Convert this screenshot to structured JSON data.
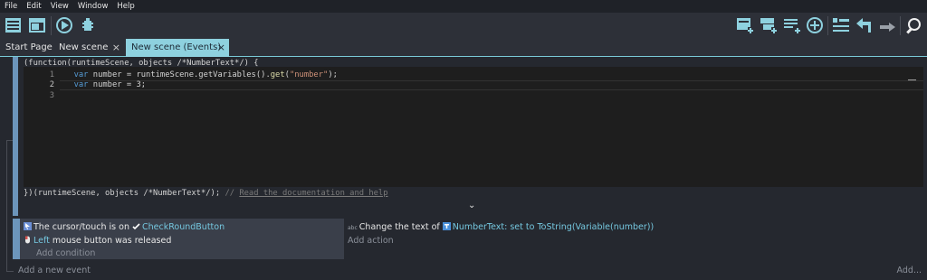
{
  "menubar": {
    "items": [
      "File",
      "Edit",
      "View",
      "Window",
      "Help"
    ]
  },
  "toolbar": {
    "left": [
      "project-manager-icon",
      "scene-editor-icon",
      "preview-play-icon",
      "debugger-icon"
    ],
    "right": [
      "add-event-icon",
      "add-sub-event-icon",
      "add-comment-icon",
      "add-other-icon",
      "select-icon",
      "undo-icon",
      "redo-icon",
      "search-icon"
    ]
  },
  "tabs": [
    {
      "label": "Start Page",
      "closable": false,
      "active": false
    },
    {
      "label": "New scene",
      "closable": true,
      "active": false
    },
    {
      "label": "New scene (Events)",
      "closable": true,
      "active": true
    }
  ],
  "close_glyph": "×",
  "code_block": {
    "header": "(function(runtimeScene, objects /*NumberText*/) {",
    "line_numbers": [
      "1",
      "2",
      "3"
    ],
    "lines": [
      {
        "indent": "  ",
        "kw": "var",
        "rest": " number = runtimeScene.getVariables().",
        "fn": "get",
        "open": "(",
        "str": "\"number\"",
        "close": ");"
      },
      {
        "indent": "  ",
        "kw": "var",
        "rest": " number = 3;",
        "fn": "",
        "open": "",
        "str": "",
        "close": ""
      },
      {
        "indent": "",
        "kw": "",
        "rest": "",
        "fn": "",
        "open": "",
        "str": "",
        "close": ""
      }
    ],
    "footer_code": "})(runtimeScene, objects /*NumberText*/);",
    "footer_comment": " // ",
    "doc_link": "Read the documentation and help",
    "expand_icon": "chevron-down-icon",
    "expand_glyph": "⌄"
  },
  "event": {
    "conditions": [
      {
        "icon": "cursor-icon",
        "text": "The cursor/touch is on ",
        "object_icon": "button-object-icon",
        "object": "CheckRoundButton"
      },
      {
        "icon": "mouse-icon",
        "param": "Left",
        "text": " mouse button was released"
      }
    ],
    "add_condition": "Add condition",
    "actions": [
      {
        "icon": "text-icon",
        "prefix": "abc",
        "text": "Change the text of ",
        "object_icon": "text-object-icon",
        "object": "NumberText",
        "rest": ": set to ",
        "param": "ToString(Variable(number))"
      }
    ],
    "add_action": "Add action"
  },
  "footer": {
    "add_event": "Add a new event",
    "add_more": "Add..."
  },
  "colors": {
    "accent": "#8ed1df",
    "block_border": "#6c95bb",
    "keyword": "#569cd6",
    "string": "#ce9178",
    "object": "#75c8e0"
  }
}
